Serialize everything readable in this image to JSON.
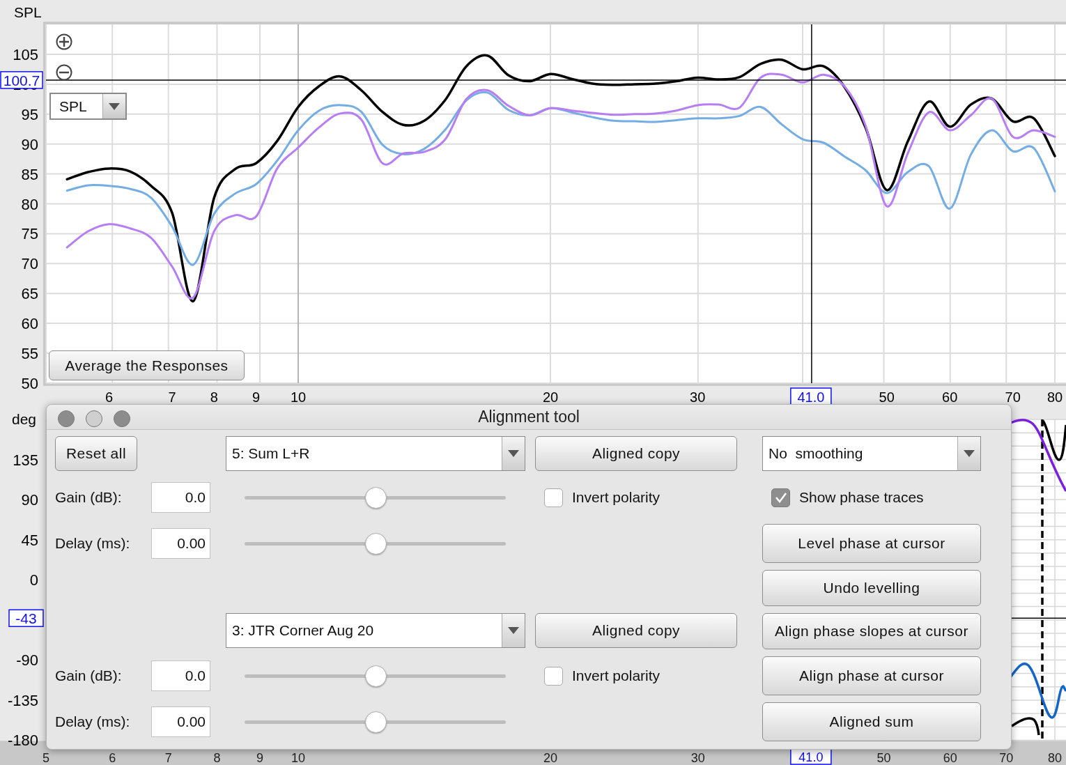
{
  "spl_chart": {
    "measurement_select": {
      "value": "SPL"
    },
    "average_button": "Average the Responses",
    "cursor": {
      "x_label": "41.0"
    },
    "chart_data": {
      "type": "line",
      "ylabel": "SPL",
      "ylim": [
        50,
        110
      ],
      "grid": true,
      "ref_lines": [
        {
          "axis": "y",
          "value": 100.7,
          "label": "100.7"
        }
      ],
      "yticks": [
        50,
        55,
        60,
        65,
        70,
        75,
        80,
        85,
        90,
        95,
        100,
        105
      ],
      "categories": [
        null,
        null,
        null,
        "6",
        null,
        null,
        "7",
        null,
        "8",
        null,
        "9",
        null,
        "10",
        null,
        null,
        null,
        null,
        null,
        null,
        null,
        null,
        null,
        null,
        null,
        "20",
        null,
        null,
        null,
        null,
        null,
        null,
        "30",
        null,
        null,
        null,
        null,
        null,
        null,
        null,
        null,
        "50",
        null,
        null,
        "60",
        null,
        null,
        "70",
        null,
        "80"
      ],
      "series": [
        {
          "color": "#000000",
          "values": [
            null,
            84.1,
            85.3,
            85.9,
            85.4,
            83,
            78.5,
            63.7,
            81,
            85.8,
            86.8,
            90.5,
            96.2,
            99.7,
            101.3,
            99,
            95.4,
            93.2,
            93.9,
            97.4,
            103,
            104.8,
            101.5,
            100.5,
            101.7,
            100.9,
            100.1,
            99.9,
            100,
            100.1,
            100.5,
            101.1,
            100.8,
            101.2,
            103.4,
            104.1,
            102.5,
            103,
            99.5,
            92.7,
            82.3,
            90.4,
            97.1,
            92.9,
            96.6,
            97.6,
            93.8,
            94.3,
            88
          ]
        },
        {
          "color": "#74ade3",
          "values": [
            null,
            82.2,
            83.1,
            83,
            82.5,
            81,
            76.2,
            69.8,
            78.3,
            81.7,
            83.3,
            87.2,
            92.3,
            95.6,
            96.5,
            95.4,
            89.9,
            88.3,
            89.2,
            92.4,
            97.3,
            98.6,
            95.7,
            94.8,
            96,
            95.3,
            94.5,
            93.9,
            93.8,
            93.7,
            94,
            94.3,
            94.3,
            94.7,
            96.2,
            93.3,
            90.8,
            90.2,
            87.9,
            85.6,
            81.8,
            85.3,
            86.3,
            79.2,
            88.2,
            92.3,
            88.8,
            89.3,
            82.1
          ]
        },
        {
          "color": "#b77df2",
          "values": [
            null,
            72.7,
            75.4,
            76.6,
            75.9,
            74.3,
            69.5,
            64.3,
            75.4,
            78.1,
            77.9,
            85.9,
            89.4,
            92.8,
            95.1,
            94.1,
            86.8,
            88.4,
            88.7,
            90.8,
            97.5,
            99,
            96.4,
            94.8,
            96,
            95.6,
            95.2,
            94.9,
            95,
            95.1,
            95.6,
            96.5,
            96.6,
            96.1,
            101.1,
            101.6,
            100.3,
            101.6,
            99.6,
            93,
            79.6,
            88.4,
            95.3,
            92.3,
            94.8,
            97.6,
            91.2,
            92.3,
            91.2
          ]
        }
      ]
    }
  },
  "phase_chart": {
    "ylabel": "deg",
    "yticks": [
      "135",
      "90",
      "45",
      "0",
      "-90",
      "-135",
      "-180"
    ],
    "xticks": [
      "5",
      "6",
      "7",
      "8",
      "9",
      "10",
      "20",
      "30",
      "50",
      "60",
      "70",
      "80"
    ],
    "cursor": {
      "x_label": "41.0",
      "y_label": "-43"
    }
  },
  "dialog": {
    "title": "Alignment tool",
    "reset_button": "Reset all",
    "channels": [
      {
        "measurement": "5: Sum L+R",
        "copy_button": "Aligned copy",
        "gain_label": "Gain (dB):",
        "gain": "0.0",
        "gain_slider": {
          "level": 0.5
        },
        "invert_label": "Invert polarity",
        "invert_checked": false,
        "delay_label": "Delay (ms):",
        "delay": "0.00",
        "delay_slider": {
          "level": 0.5
        }
      },
      {
        "measurement": "3: JTR Corner Aug 20",
        "copy_button": "Aligned copy",
        "gain_label": "Gain (dB):",
        "gain": "0.0",
        "gain_slider": {
          "level": 0.5
        },
        "invert_label": "Invert polarity",
        "invert_checked": false,
        "delay_label": "Delay (ms):",
        "delay": "0.00",
        "delay_slider": {
          "level": 0.5
        }
      }
    ],
    "smoothing": "No  smoothing",
    "show_phase": {
      "label": "Show phase traces",
      "checked": true
    },
    "actions": [
      "Level phase at cursor",
      "Undo levelling",
      "Align phase slopes at cursor",
      "Align phase at cursor",
      "Aligned sum"
    ]
  }
}
